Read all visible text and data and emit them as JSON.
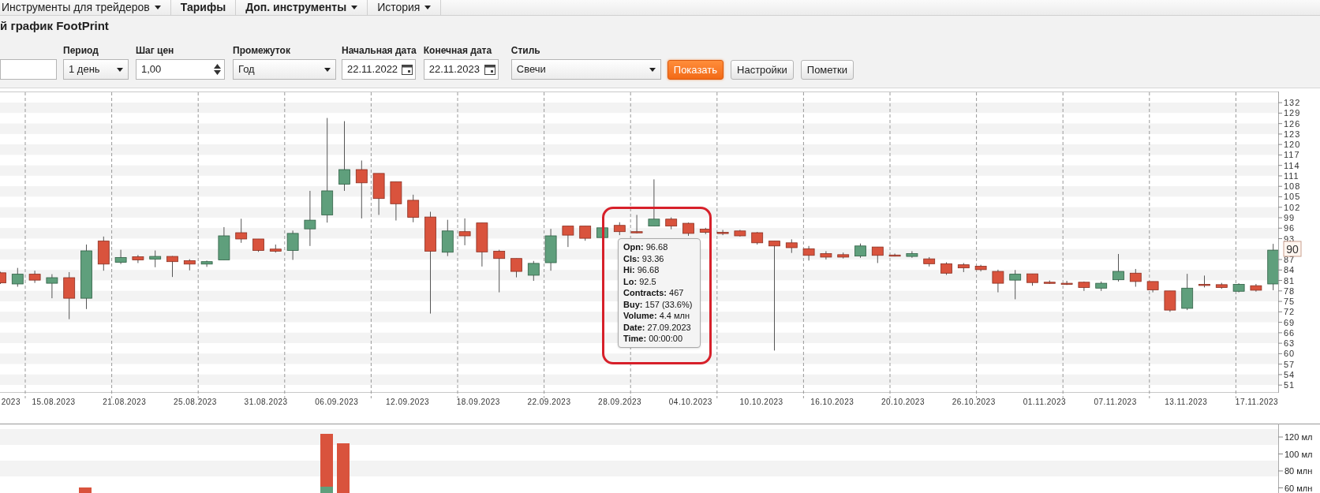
{
  "nav": [
    {
      "label": "Инструменты для трейдеров",
      "bold": false,
      "has_menu": true
    },
    {
      "label": "Тарифы",
      "bold": true,
      "has_menu": false
    },
    {
      "label": "Доп. инструменты",
      "bold": true,
      "has_menu": true
    },
    {
      "label": "История",
      "bold": false,
      "has_menu": true
    }
  ],
  "page_title": "й график FootPrint",
  "form": {
    "fields": [
      {
        "kind": "text"
      },
      {
        "kind": "select",
        "label": "Период",
        "value": "1 день"
      },
      {
        "kind": "spinner",
        "label": "Шаг цен",
        "value": "1,00"
      },
      {
        "kind": "select",
        "label": "Промежуток",
        "value": "Год"
      },
      {
        "kind": "date",
        "label": "Начальная дата",
        "value": "22.11.2022"
      },
      {
        "kind": "date",
        "label": "Конечная дата",
        "value": "22.11.2023"
      },
      {
        "kind": "select",
        "label": "Стиль",
        "value": "Свечи"
      }
    ],
    "buttons": [
      {
        "label": "Показать",
        "primary": true
      },
      {
        "label": "Настройки",
        "primary": false
      },
      {
        "label": "Пометки",
        "primary": false
      }
    ]
  },
  "chart": {
    "chart_data": {
      "type": "candlestick",
      "ylim": [
        49,
        135.2
      ],
      "ohlc": [
        [
          83.2,
          83.5,
          80,
          80.3
        ],
        [
          80,
          84.6,
          79.2,
          82.8
        ],
        [
          82.8,
          83.8,
          80.3,
          81.1
        ],
        [
          80.2,
          82.8,
          75.9,
          81.8
        ],
        [
          81.8,
          83.4,
          69.9,
          75.9
        ],
        [
          75.9,
          91.3,
          72.8,
          89.5
        ],
        [
          92.3,
          93.6,
          83.8,
          85.7
        ],
        [
          86.2,
          89.8,
          85.7,
          87.6
        ],
        [
          87.8,
          88.3,
          86,
          86.9
        ],
        [
          87.1,
          89.6,
          84.8,
          87.9
        ],
        [
          87.9,
          88,
          82,
          86.4
        ],
        [
          86.7,
          87.1,
          83.9,
          85.7
        ],
        [
          85.7,
          86.7,
          84.9,
          86.4
        ],
        [
          86.9,
          96.3,
          86.9,
          93.8
        ],
        [
          94.7,
          98.7,
          91.8,
          92.9
        ],
        [
          92.9,
          92.9,
          89.2,
          89.6
        ],
        [
          90,
          91.3,
          89,
          89.4
        ],
        [
          89.6,
          95.3,
          86.9,
          94.5
        ],
        [
          95.8,
          106.7,
          90.9,
          98.3
        ],
        [
          99.8,
          127.6,
          97.6,
          106.7
        ],
        [
          108.6,
          126.7,
          106.7,
          112.8
        ],
        [
          112.8,
          115.4,
          98.8,
          109
        ],
        [
          111.7,
          111.7,
          99.8,
          104.5
        ],
        [
          109.3,
          109.3,
          98.2,
          103
        ],
        [
          104,
          105.6,
          97.7,
          99.1
        ],
        [
          99.2,
          100.7,
          71.5,
          89.4
        ],
        [
          89.1,
          98.4,
          88,
          95.2
        ],
        [
          95,
          98.8,
          91.1,
          93.8
        ],
        [
          97.5,
          97.5,
          85,
          89.2
        ],
        [
          89.4,
          89.8,
          77.6,
          87.3
        ],
        [
          87.3,
          87.3,
          81.9,
          83.6
        ],
        [
          82.5,
          86.6,
          80.9,
          85.9
        ],
        [
          86.1,
          95.8,
          83.8,
          93.8
        ],
        [
          96.6,
          96.6,
          90.6,
          94
        ],
        [
          96.6,
          96.6,
          92.4,
          93.1
        ],
        [
          93.3,
          96.3,
          93.3,
          96.1
        ],
        [
          96.8,
          97.7,
          94,
          95
        ],
        [
          95,
          99.8,
          94.5,
          94.9
        ],
        [
          96.6,
          110,
          96.6,
          98.6
        ],
        [
          98.6,
          99.1,
          95.7,
          96.6
        ],
        [
          97.4,
          97.6,
          93.8,
          94.5
        ],
        [
          95.7,
          96.1,
          94.3,
          94.8
        ],
        [
          94.8,
          95.5,
          94,
          94.7
        ],
        [
          95.2,
          95.5,
          93.6,
          93.8
        ],
        [
          94.7,
          94.9,
          91.3,
          91.8
        ],
        [
          92.3,
          92.3,
          60.9,
          90.9
        ],
        [
          91.8,
          92.8,
          88.9,
          90.4
        ],
        [
          90.1,
          90.9,
          86.7,
          88.2
        ],
        [
          88.7,
          89.4,
          87,
          87.7
        ],
        [
          88.4,
          89,
          87.3,
          87.7
        ],
        [
          88,
          91.6,
          87.5,
          90.9
        ],
        [
          90.6,
          90.6,
          86,
          88.2
        ],
        [
          88.3,
          88.7,
          87.9,
          88.1
        ],
        [
          87.9,
          89.4,
          87.5,
          88.7
        ],
        [
          87.2,
          87.7,
          85,
          85.8
        ],
        [
          85.8,
          86.2,
          82.6,
          83.1
        ],
        [
          85.5,
          86,
          83.4,
          84.6
        ],
        [
          85.1,
          85.5,
          83.6,
          84.1
        ],
        [
          83.6,
          84.1,
          77.6,
          80.2
        ],
        [
          81.1,
          84,
          75.6,
          82.8
        ],
        [
          82.9,
          82.9,
          79.5,
          80.4
        ],
        [
          80.5,
          81,
          80,
          80.4
        ],
        [
          80.2,
          80.9,
          79.7,
          80.1
        ],
        [
          80.5,
          80.7,
          78,
          79
        ],
        [
          78.8,
          80.7,
          78,
          80.2
        ],
        [
          81.2,
          88.6,
          80.7,
          83.6
        ],
        [
          83.1,
          84.3,
          79.2,
          80.7
        ],
        [
          80.7,
          80.7,
          77.6,
          78.3
        ],
        [
          78,
          78,
          72,
          72.5
        ],
        [
          73,
          82.9,
          72.5,
          78.8
        ],
        [
          79.9,
          82.4,
          79,
          79.7
        ],
        [
          79.8,
          80.3,
          78.6,
          79
        ],
        [
          77.9,
          80.2,
          77.6,
          79.9
        ],
        [
          79.5,
          80,
          77.8,
          78.2
        ],
        [
          80,
          91.5,
          78.2,
          89.7
        ]
      ],
      "yticks": [
        132,
        129,
        126,
        123,
        120,
        117,
        114,
        111,
        108,
        105,
        102,
        99,
        96,
        93,
        87,
        84,
        81,
        78,
        75,
        72,
        69,
        66,
        63,
        60,
        57,
        54,
        51
      ]
    },
    "current_price": "90",
    "x_axis_labels": [
      "2023",
      "15.08.2023",
      "21.08.2023",
      "25.08.2023",
      "31.08.2023",
      "06.09.2023",
      "12.09.2023",
      "18.09.2023",
      "22.09.2023",
      "28.09.2023",
      "04.10.2023",
      "10.10.2023",
      "16.10.2023",
      "20.10.2023",
      "26.10.2023",
      "01.11.2023",
      "07.11.2023",
      "13.11.2023",
      "17.11.2023"
    ],
    "tooltip": {
      "rows": [
        "**Opn:** 96.68",
        "**Cls:** 93.36",
        "**Hi:** 96.68",
        "**Lo:** 92.5",
        "**Contracts:** 467",
        "**Buy:** 157 (33.6%)",
        "**Volume:** 4.4 млн",
        "**Date:** 27.09.2023",
        "**Time:** 00:00:00"
      ]
    }
  },
  "volume": {
    "axis_labels": [
      "120 мл",
      "100 мл",
      "80 млн",
      "60 млн"
    ]
  }
}
